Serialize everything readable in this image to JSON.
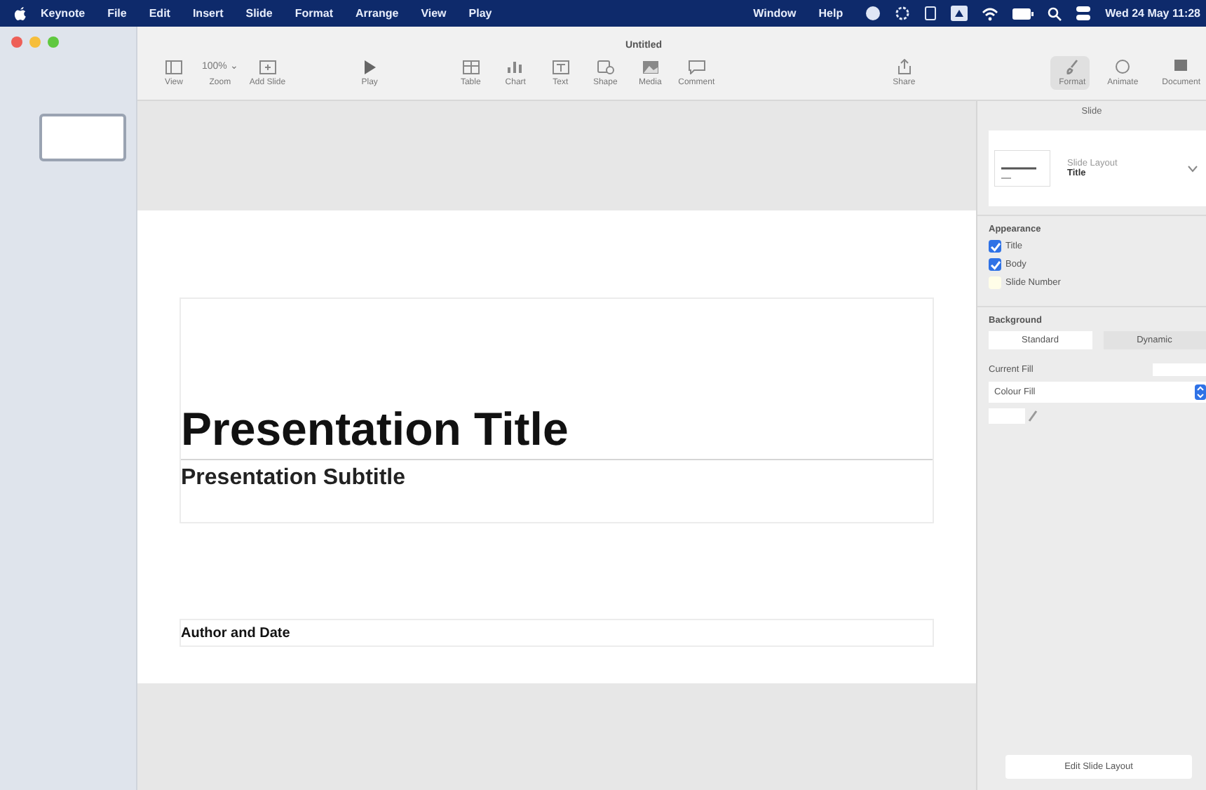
{
  "menu_bar": {
    "app": "Keynote",
    "items": [
      "File",
      "Edit",
      "Insert",
      "Slide",
      "Format",
      "Arrange",
      "View",
      "Play",
      "Window",
      "Help"
    ],
    "clock": "Wed 24 May 11:28"
  },
  "window": {
    "title": "Untitled"
  },
  "toolbar": {
    "left": [
      {
        "kind": "grid",
        "label": "View"
      },
      {
        "kind": "zoom",
        "label": "Zoom",
        "value": "100% ⌄"
      },
      {
        "kind": "slide",
        "label": "Add Slide"
      }
    ],
    "play": {
      "kind": "play",
      "label": "Play"
    },
    "middle": [
      {
        "kind": "table",
        "label": "Table"
      },
      {
        "kind": "chart",
        "label": "Chart"
      },
      {
        "kind": "text",
        "label": "Text"
      },
      {
        "kind": "shape",
        "label": "Shape"
      },
      {
        "kind": "media",
        "label": "Media"
      },
      {
        "kind": "comment",
        "label": "Comment"
      }
    ],
    "share": {
      "kind": "share",
      "label": "Share"
    },
    "right": [
      {
        "kind": "format",
        "label": "Format",
        "selected": true
      },
      {
        "kind": "animate",
        "label": "Animate",
        "selected": false
      },
      {
        "kind": "document",
        "label": "Document",
        "selected": false
      }
    ]
  },
  "slide": {
    "title": "Presentation Title",
    "subtitle": "Presentation Subtitle",
    "author": "Author and Date"
  },
  "inspector": {
    "tab": "Slide",
    "layout_caption": "Slide Layout",
    "layout_name": "Title",
    "appearance_heading": "Appearance",
    "appearance": [
      {
        "label": "Title",
        "checked": true
      },
      {
        "label": "Body",
        "checked": true
      },
      {
        "label": "Slide Number",
        "checked": false
      }
    ],
    "background_heading": "Background",
    "background_modes": [
      {
        "label": "Standard",
        "selected": true
      },
      {
        "label": "Dynamic",
        "selected": false
      }
    ],
    "fill_heading": "Current Fill",
    "fill_type": "Colour Fill",
    "edit_button": "Edit Slide Layout"
  }
}
